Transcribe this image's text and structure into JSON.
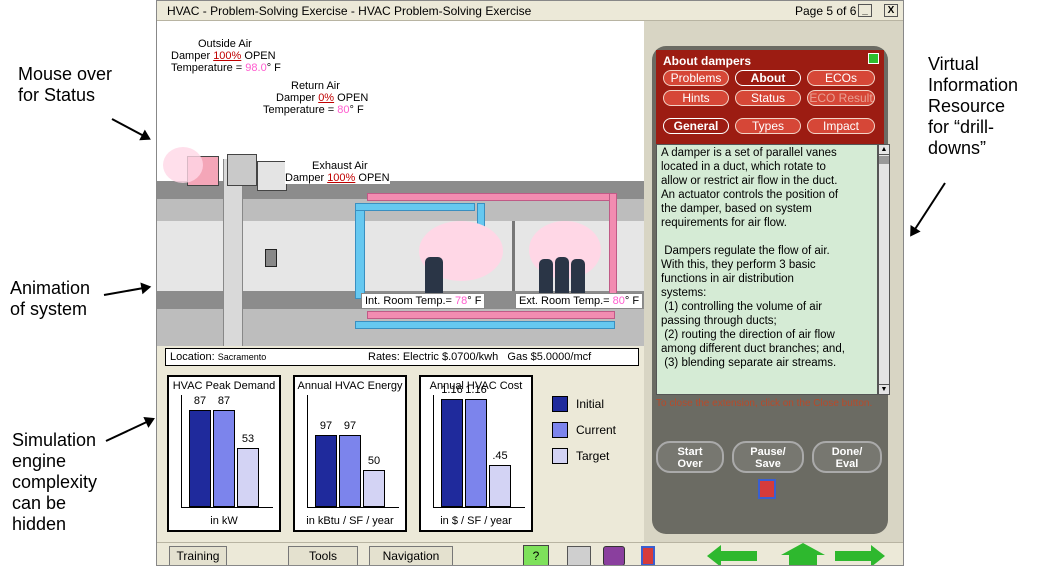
{
  "annotations": {
    "mouse_over": [
      "Mouse over",
      "for Status"
    ],
    "animation": [
      "Animation",
      "of system"
    ],
    "simulation": [
      "Simulation",
      "engine",
      "complexity",
      "can be",
      "hidden"
    ],
    "virtual": [
      "Virtual",
      "Information",
      "Resource",
      "for “drill-",
      "downs”"
    ]
  },
  "window": {
    "title": "HVAC - Problem-Solving Exercise - HVAC Problem-Solving Exercise",
    "page": "Page 5 of 6",
    "minimize": "_",
    "close": "X"
  },
  "scene": {
    "outside_air": {
      "title": "Outside Air",
      "damper_prefix": "Damper ",
      "damper_value": "100%",
      "damper_suffix": " OPEN",
      "temp_prefix": "Temperature = ",
      "temp_value": "98.0",
      "temp_suffix": "° F"
    },
    "return_air": {
      "title": "Return Air",
      "damper_prefix": "Damper ",
      "damper_value": "0%",
      "damper_suffix": " OPEN",
      "temp_prefix": "Temperature = ",
      "temp_value": "80",
      "temp_suffix": "° F"
    },
    "exhaust_air": {
      "title": "Exhaust Air",
      "damper_prefix": "Damper ",
      "damper_value": "100%",
      "damper_suffix": " OPEN"
    },
    "int_room": {
      "prefix": "Int. Room Temp.= ",
      "value": "78",
      "suffix": "° F"
    },
    "ext_room": {
      "prefix": "Ext. Room Temp.= ",
      "value": "80",
      "suffix": "° F"
    }
  },
  "location_bar": {
    "location_label": "Location: ",
    "location_value": "Sacramento",
    "rates": "Rates: Electric $.0700/kwh   Gas $5.0000/mcf"
  },
  "chart_data": [
    {
      "type": "bar",
      "title": "HVAC Peak Demand",
      "xlabel": "in kW",
      "categories": [
        "Initial",
        "Current",
        "Target"
      ],
      "values": [
        87,
        87,
        53
      ],
      "labels": [
        "87",
        "87",
        "53"
      ],
      "ylim": [
        0,
        100
      ]
    },
    {
      "type": "bar",
      "title": "Annual HVAC Energy",
      "xlabel": "in kBtu / SF / year",
      "categories": [
        "Initial",
        "Current",
        "Target"
      ],
      "values": [
        97,
        97,
        50
      ],
      "labels": [
        "97",
        "97",
        "50"
      ],
      "ylim": [
        0,
        150
      ]
    },
    {
      "type": "bar",
      "title": "Annual HVAC Cost",
      "xlabel": "in $ / SF / year",
      "categories": [
        "Initial",
        "Current",
        "Target"
      ],
      "values": [
        1.16,
        1.16,
        0.45
      ],
      "labels": [
        "1.16",
        "1.16",
        ".45"
      ],
      "ylim": [
        0,
        1.2
      ]
    }
  ],
  "legend": [
    {
      "label": "Initial",
      "color": "#1f2a9c"
    },
    {
      "label": "Current",
      "color": "#7c84ec"
    },
    {
      "label": "Target",
      "color": "#d3d3f4"
    }
  ],
  "panel": {
    "title": "About dampers",
    "row1": [
      "Problems",
      "About",
      "ECOs"
    ],
    "row2": [
      "Hints",
      "Status",
      "ECO Result"
    ],
    "row3": [
      "General",
      "Types",
      "Impact"
    ],
    "text": "A damper is a set of parallel vanes\nlocated in a duct, which rotate to\nallow or restrict air flow in the duct.\nAn actuator controls the position of\nthe damper, based on system\nrequirements for air flow.\n\n Dampers regulate the flow of air.\nWith this, they perform 3 basic\nfunctions in air distribution\nsystems:\n (1) controlling the volume of air\npassing through ducts;\n (2) routing the direction of air flow\namong different duct branches; and,\n (3) blending separate air streams.",
    "close_msg": "To close the extension, click on the Close button.",
    "start_over": [
      "Start",
      "Over"
    ],
    "pause_save": [
      "Pause/",
      "Save"
    ],
    "done_eval": [
      "Done/",
      "Eval"
    ]
  },
  "bottom": {
    "training": "Training",
    "tools": "Tools",
    "navigation": "Navigation"
  },
  "colors": {
    "accent_red": "#9c1c12",
    "text_green": "#d5ebd5",
    "arrow_green": "#2eb82e"
  }
}
